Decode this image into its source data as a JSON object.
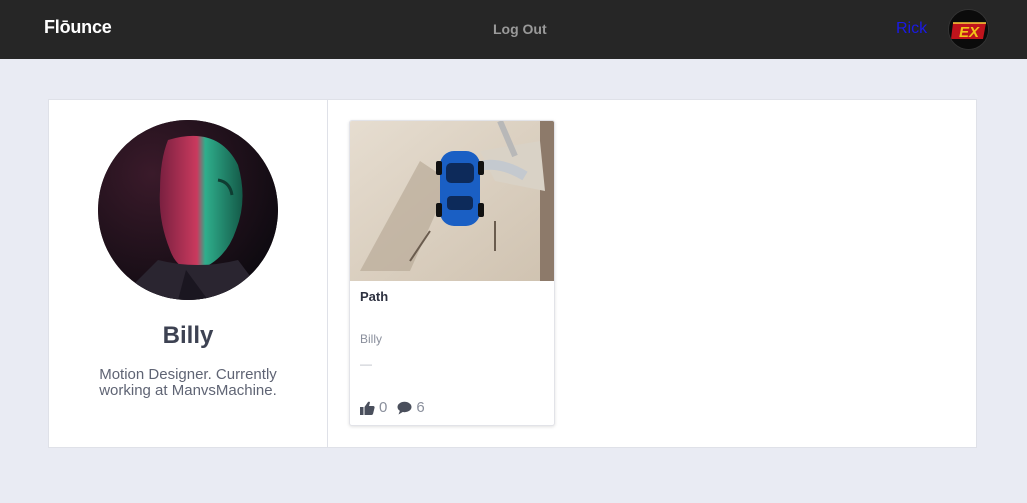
{
  "nav": {
    "brand": "Flōunce",
    "logout_label": "Log Out",
    "username": "Rick",
    "avatar_icon": "user-avatar-ex-logo"
  },
  "profile": {
    "name": "Billy",
    "bio": "Motion Designer. Currently working at ManvsMachine.",
    "photo_icon": "profile-photo"
  },
  "posts": [
    {
      "title": "Path",
      "author": "Billy",
      "description": "—",
      "likes": "0",
      "comments": "6",
      "thumbnail_icon": "blue-car-aerial-image"
    }
  ],
  "colors": {
    "nav_background": "#262626",
    "page_background": "#e9ebf3",
    "username_link": "#1a1ae6"
  }
}
